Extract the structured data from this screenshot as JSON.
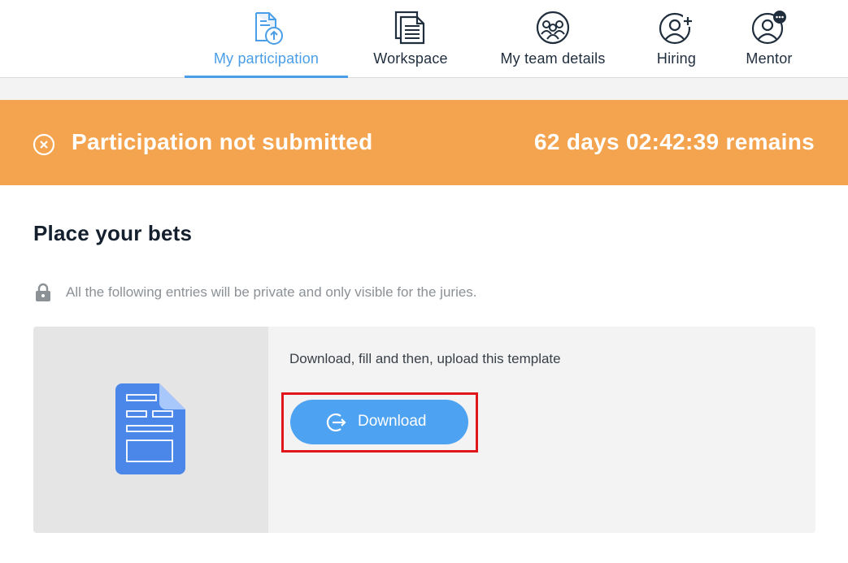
{
  "nav": {
    "items": [
      {
        "label": "My participation",
        "icon": "upload-document-icon",
        "active": true
      },
      {
        "label": "Workspace",
        "icon": "documents-icon",
        "active": false
      },
      {
        "label": "My team details",
        "icon": "team-icon",
        "active": false
      },
      {
        "label": "Hiring",
        "icon": "add-user-icon",
        "active": false
      },
      {
        "label": "Mentor",
        "icon": "mentor-chat-icon",
        "active": false
      }
    ]
  },
  "banner": {
    "status": "Participation not submitted",
    "countdown": "62 days 02:42:39 remains",
    "icon": "close-circle-icon",
    "color": "#f4a34e"
  },
  "main": {
    "title": "Place your bets",
    "privacy_note": "All the following entries will be private and only visible for the juries.",
    "template": {
      "instruction": "Download, fill and then, upload this template",
      "button_label": "Download",
      "button_icon": "download-arrow-icon",
      "thumbnail_icon": "google-doc-icon"
    }
  },
  "colors": {
    "accent": "#4a9ee8",
    "button": "#4da2f2",
    "highlight": "#e0161b"
  }
}
